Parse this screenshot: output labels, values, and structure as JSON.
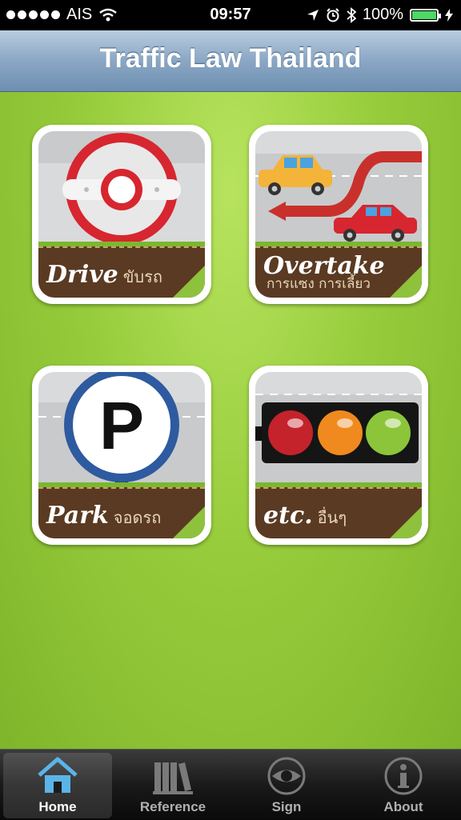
{
  "status_bar": {
    "carrier": "AIS",
    "time": "09:57",
    "battery_percent": "100%",
    "icons": [
      "signal-dots-icon",
      "wifi-icon",
      "location-arrow-icon",
      "alarm-icon",
      "bluetooth-icon",
      "battery-icon",
      "charging-icon"
    ]
  },
  "nav": {
    "title": "Traffic Law Thailand"
  },
  "tiles": [
    {
      "label": "Drive",
      "thai": "ขับรถ",
      "icon": "steering-wheel-icon"
    },
    {
      "label": "Overtake",
      "thai": "การแซง การเลี้ยว",
      "icon": "overtake-cars-icon"
    },
    {
      "label": "Park",
      "thai": "จอดรถ",
      "icon": "parking-sign-icon"
    },
    {
      "label": "etc.",
      "thai": "อื่นๆ",
      "icon": "traffic-light-icon"
    }
  ],
  "tabs": [
    {
      "label": "Home",
      "icon": "house-icon",
      "selected": true
    },
    {
      "label": "Reference",
      "icon": "books-icon",
      "selected": false
    },
    {
      "label": "Sign",
      "icon": "eye-icon",
      "selected": false
    },
    {
      "label": "About",
      "icon": "info-icon",
      "selected": false
    }
  ],
  "colors": {
    "background_green": "#97cd3c",
    "nav_blue": "#8aa7c4",
    "tab_selected_blue": "#5ab4e8",
    "label_brown": "#5a3a22"
  }
}
